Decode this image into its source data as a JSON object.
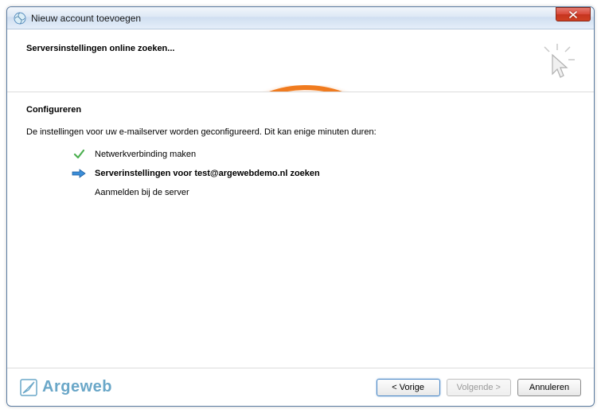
{
  "window": {
    "title": "Nieuw account toevoegen"
  },
  "header": {
    "title": "Serversinstellingen online zoeken..."
  },
  "config": {
    "section_title": "Configureren",
    "intro": "De instellingen voor uw e-mailserver worden geconfigureerd. Dit kan enige minuten duren:",
    "steps": [
      {
        "label": "Netwerkverbinding maken",
        "status": "done"
      },
      {
        "label": "Serverinstellingen voor test@argewebdemo.nl zoeken",
        "status": "active"
      },
      {
        "label": "Aanmelden bij de server",
        "status": "pending"
      }
    ]
  },
  "footer": {
    "logo_text": "Argeweb",
    "buttons": {
      "back": "< Vorige",
      "next": "Volgende >",
      "cancel": "Annuleren"
    }
  }
}
